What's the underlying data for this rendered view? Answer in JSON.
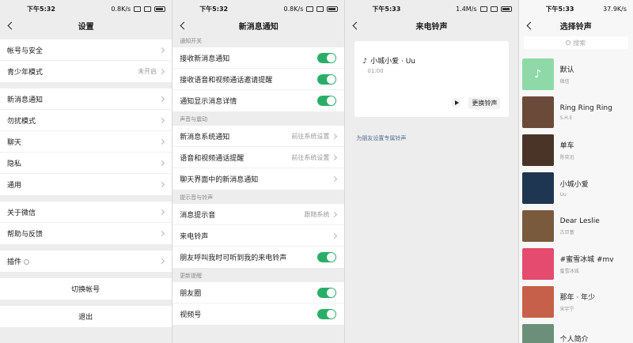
{
  "statusbars": [
    {
      "time": "下午5:32",
      "speed": "0.8K/s"
    },
    {
      "time": "下午5:32",
      "speed": "0.8K/s"
    },
    {
      "time": "下午5:33",
      "speed": "1.4M/s"
    },
    {
      "time": "下午5:33",
      "speed": "37.9K/s"
    }
  ],
  "settings": {
    "title": "设置",
    "account": "帐号与安全",
    "teen_mode": "青少年模式",
    "teen_mode_value": "未开启",
    "notifications": "新消息通知",
    "dnd": "勿扰模式",
    "chat": "聊天",
    "privacy": "隐私",
    "general": "通用",
    "about": "关于微信",
    "help": "帮助与反馈",
    "plugins": "插件",
    "switch_account": "切换帐号",
    "logout": "退出"
  },
  "notify": {
    "title": "新消息通知",
    "section_switch": "通知开关",
    "receive_new": "接收新消息通知",
    "receive_call": "接收语音和视频通话邀请提醒",
    "show_detail": "通知显示消息详情",
    "section_sound": "声音与震动",
    "system_notify": "新消息系统通知",
    "system_notify_value": "前往系统设置",
    "call_notify": "语音和视频通话提醒",
    "call_notify_value": "前往系统设置",
    "chat_notify": "聊天界面中的新消息通知",
    "section_ringtone": "提示音与铃声",
    "msg_sound": "消息提示音",
    "msg_sound_value": "跟随系统",
    "ringtone": "来电铃声",
    "friend_ringtone": "朋友呼叫我时可听到我的来电铃声",
    "section_updates": "更新提醒",
    "moments": "朋友圈",
    "channels": "视频号"
  },
  "ringtone_page": {
    "title": "来电铃声",
    "song": "小城小爱 · Uu",
    "duration": "01:00",
    "change_button": "更换铃声",
    "friend_link": "为朋友设置专属铃声"
  },
  "select_page": {
    "title": "选择铃声",
    "search_placeholder": "搜索",
    "items": [
      {
        "title": "默认",
        "artist": "微信",
        "color": "#8fd9a8",
        "icon": "music-note"
      },
      {
        "title": "Ring Ring Ring",
        "artist": "S.H.E",
        "color": "#6b4a3a"
      },
      {
        "title": "单车",
        "artist": "陈奕迅",
        "color": "#4a3428"
      },
      {
        "title": "小城小爱",
        "artist": "Uu",
        "color": "#1f3652"
      },
      {
        "title": "Dear Leslie",
        "artist": "古巨基",
        "color": "#7a5a3c"
      },
      {
        "title": "#蜜雪冰城 #mv",
        "artist": "蜜雪冰城",
        "color": "#e44b6f"
      },
      {
        "title": "那年 · 年少",
        "artist": "宋宇宁",
        "color": "#c7604a"
      },
      {
        "title": "个人简介",
        "artist": "",
        "color": "#6c8f7a"
      }
    ]
  }
}
